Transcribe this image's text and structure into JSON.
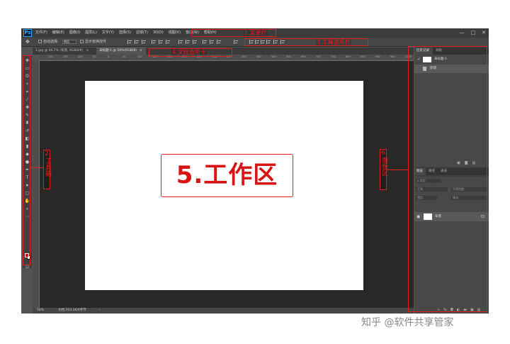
{
  "app": {
    "logo_text": "Ps",
    "menu": [
      "文件(F)",
      "编辑(E)",
      "图像(I)",
      "图层(L)",
      "文字(Y)",
      "选择(S)",
      "滤镜(T)",
      "3D(D)",
      "视图(V)",
      "窗口(W)",
      "帮助(H)"
    ],
    "window_controls": [
      "—",
      "□",
      "✕"
    ]
  },
  "options_bar": {
    "auto_select_label": "自动选择:",
    "auto_select_value": "图层",
    "transform_label": "显示变换控件"
  },
  "documents": {
    "tabs": [
      {
        "label": "1.jpg @ 44.7% (背景, RGB/8#)",
        "close": "×"
      },
      {
        "label": "未标题-1 @ 50%(RGB/8)",
        "close": "×"
      }
    ]
  },
  "ruler": {
    "ticks": [
      "200",
      "150",
      "100",
      "50",
      "0",
      "50",
      "100",
      "150",
      "200",
      "250",
      "300",
      "350",
      "400",
      "450",
      "500",
      "550",
      "600",
      "650",
      "700",
      "750",
      "800",
      "850",
      "900",
      "950",
      "1000"
    ]
  },
  "status": {
    "zoom": "50%",
    "doc_info": "文档:703.1K/0字节"
  },
  "panels": {
    "history": {
      "tabs": [
        "历史记录",
        "调板"
      ],
      "snapshot_label": "未标题-1",
      "items": [
        "新建"
      ]
    },
    "layers": {
      "tabs": [
        "图层",
        "路径",
        "通道"
      ],
      "kind_label": "ρ 类型",
      "blend_mode": "正常",
      "opacity_label": "不透明度:",
      "lock_label": "锁定:",
      "fill_label": "填充:",
      "layer_name": "背景"
    }
  },
  "annotations": {
    "menu_bar": "1.菜单栏",
    "options_bar": "3.工具选项栏",
    "doc_tabs": "4.文档选项卡",
    "toolbox_num": "2",
    "toolbox_text": "工具箱",
    "panels_num": "6",
    "panels_text": "面板区",
    "workspace": "5.工作区"
  },
  "watermark": "知乎 @软件共享管家",
  "colors": {
    "accent": "#e02020",
    "workspace": "#282828",
    "canvas": "#ffffff",
    "foreground": "#e00000"
  }
}
